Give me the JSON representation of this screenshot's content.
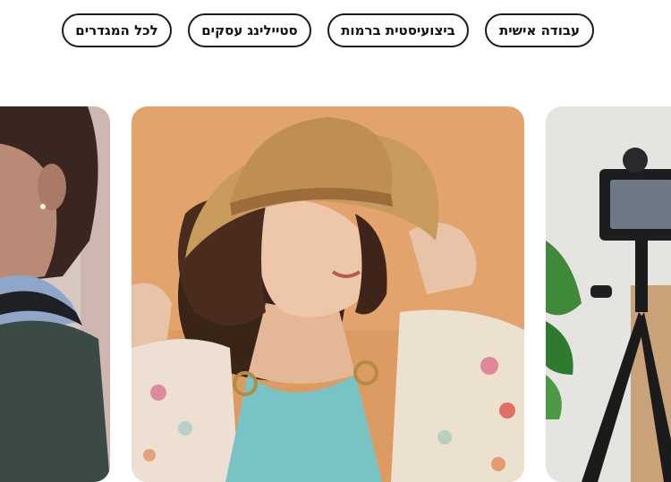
{
  "filters": {
    "personal_work": "עבודה אישית",
    "stylist_events": "ביצועיסטית ברמות",
    "business_styling": "סטיילינג עסקים",
    "all_categories": "לכל המגדרים"
  },
  "gallery": {
    "cards": [
      {
        "subject": "woman-profile-sweater"
      },
      {
        "subject": "woman-straw-hat"
      },
      {
        "subject": "camera-on-tripod"
      }
    ]
  }
}
